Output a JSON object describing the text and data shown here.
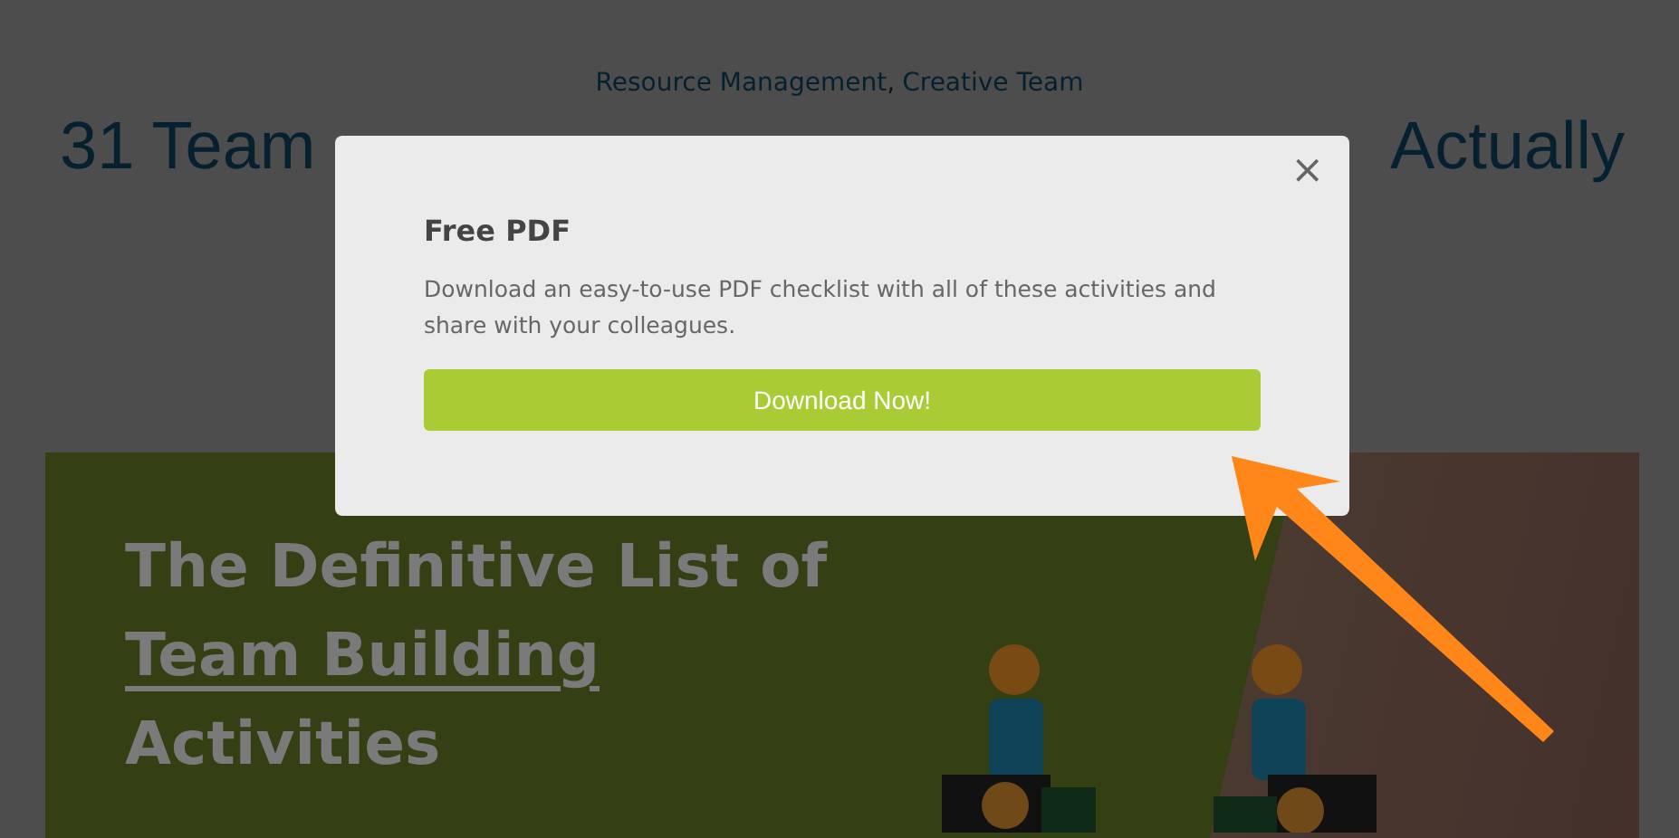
{
  "article": {
    "categories": [
      "Resource Management",
      "Creative Team"
    ],
    "category_separator": ",",
    "title_parts": [
      "31 Team",
      "Actually"
    ]
  },
  "hero": {
    "lines": [
      {
        "text": "The Definitive List of",
        "underlined": false
      },
      {
        "text": "Team Building",
        "underlined": true
      },
      {
        "text": "Activities",
        "underlined": false
      }
    ]
  },
  "modal": {
    "close": "×",
    "title": "Free PDF",
    "text": "Download an easy-to-use PDF checklist with all of these activities and share with your colleagues.",
    "button": "Download Now!"
  }
}
